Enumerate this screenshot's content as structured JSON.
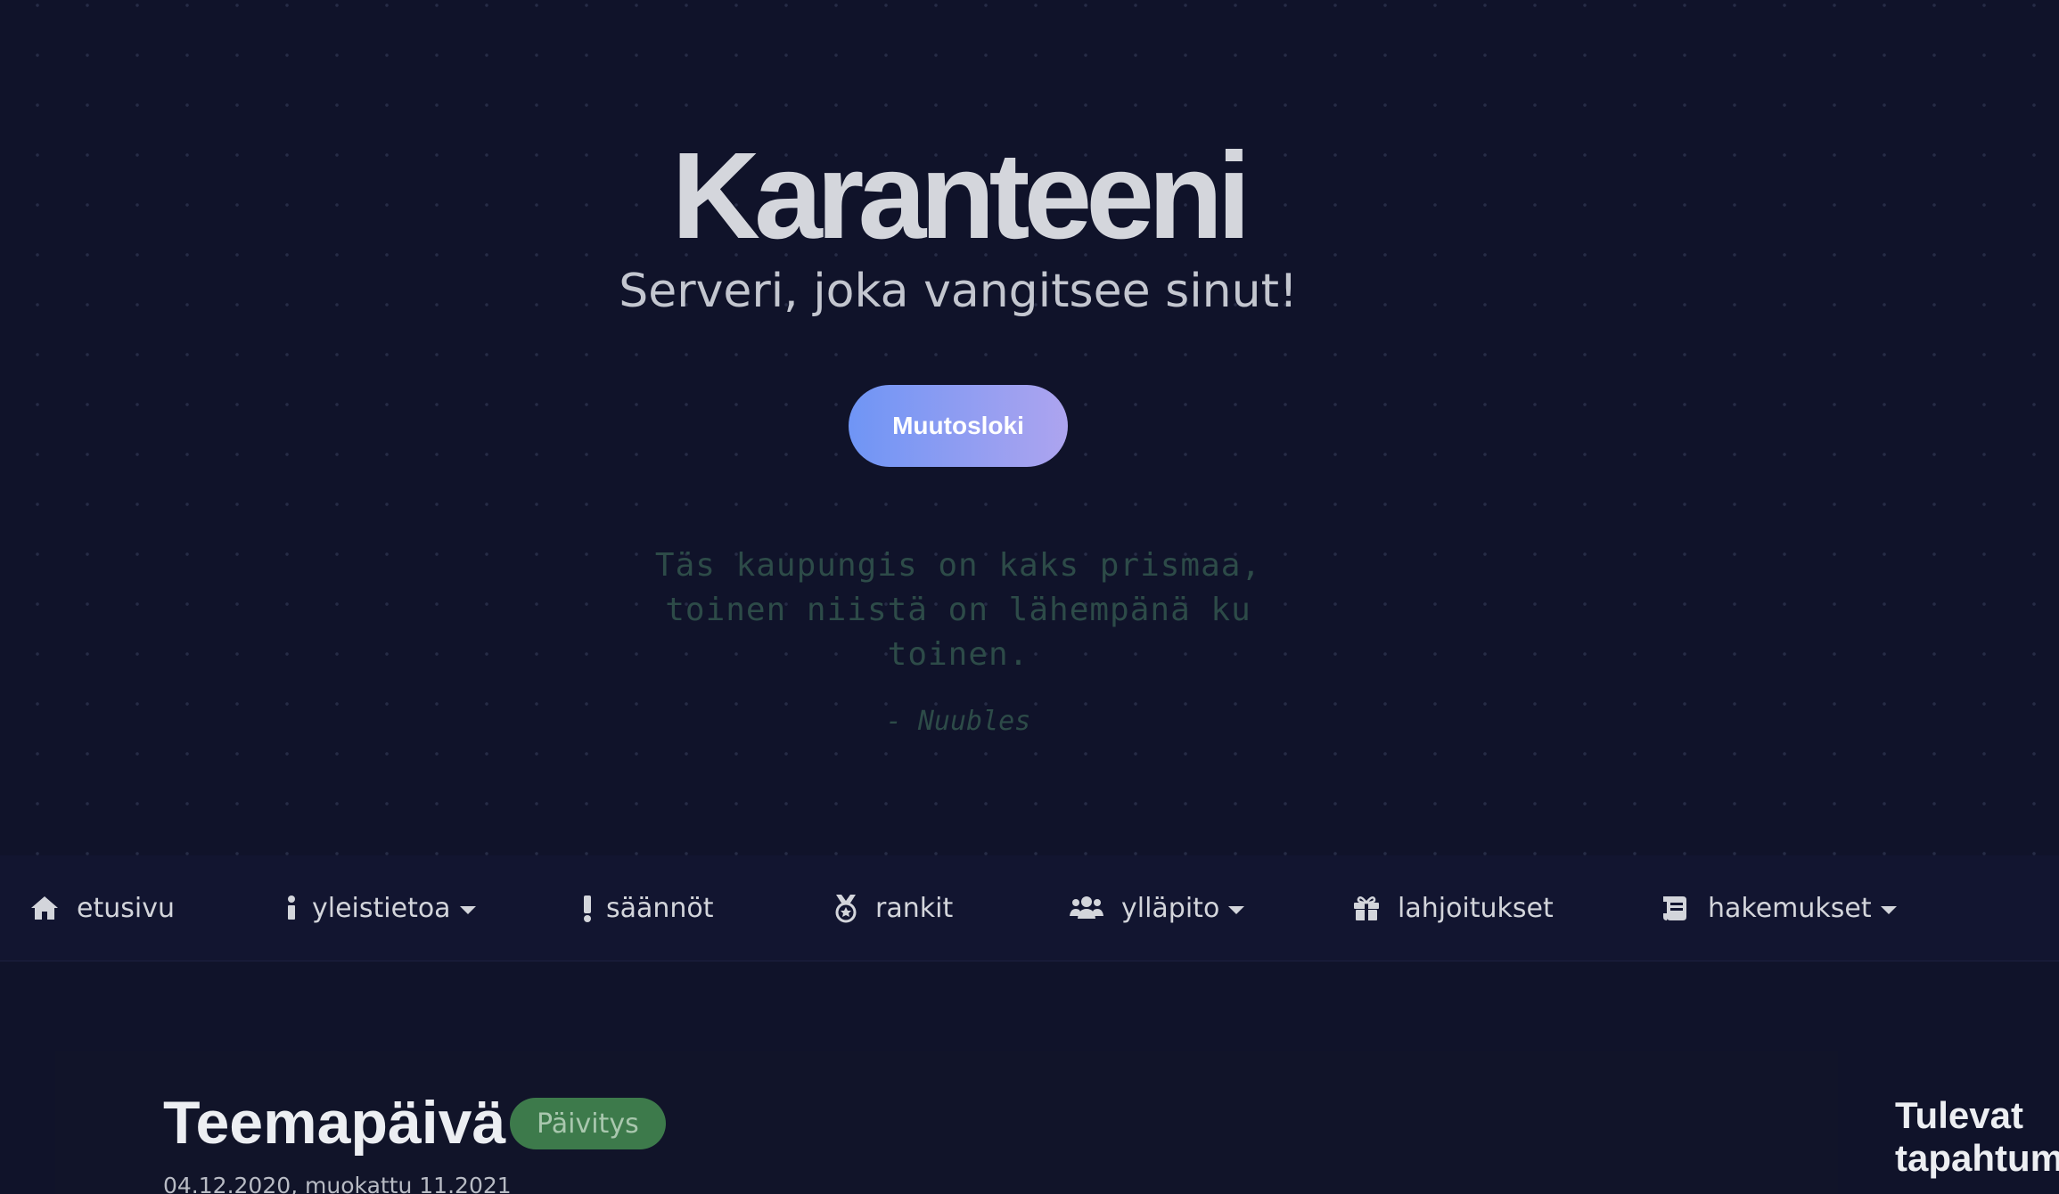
{
  "hero": {
    "title": "Karanteeni",
    "subtitle": "Serveri, joka vangitsee sinut!",
    "cta_label": "Muutosloki",
    "quote_line1": "Täs kaupungis on kaks prismaa,",
    "quote_line2": "toinen niistä on lähempänä ku",
    "quote_line3": "toinen.",
    "quote_author": "- Nuubles"
  },
  "nav": {
    "items": [
      {
        "label": "etusivu",
        "icon": "home-icon"
      },
      {
        "label": "yleistietoa",
        "icon": "info-icon",
        "dropdown": true
      },
      {
        "label": "säännöt",
        "icon": "exclamation-icon"
      },
      {
        "label": "rankit",
        "icon": "medal-icon"
      },
      {
        "label": "ylläpito",
        "icon": "users-icon",
        "dropdown": true
      },
      {
        "label": "lahjoitukset",
        "icon": "gift-icon"
      },
      {
        "label": "hakemukset",
        "icon": "scroll-icon",
        "dropdown": true
      }
    ]
  },
  "post": {
    "title": "Teemapäivä",
    "badge": "Päivitys",
    "date": "04.12.2020, muokattu 11.2021"
  },
  "sidebar": {
    "title_line1": "Tulevat",
    "title_line2": "tapahtumat"
  },
  "colors": {
    "background": "#10132a",
    "navbar": "#121530",
    "cta_gradient_start": "#6f95f5",
    "cta_gradient_end": "#ada4ef",
    "badge": "#3d7a4b",
    "quote_text": "#2d4b48"
  }
}
